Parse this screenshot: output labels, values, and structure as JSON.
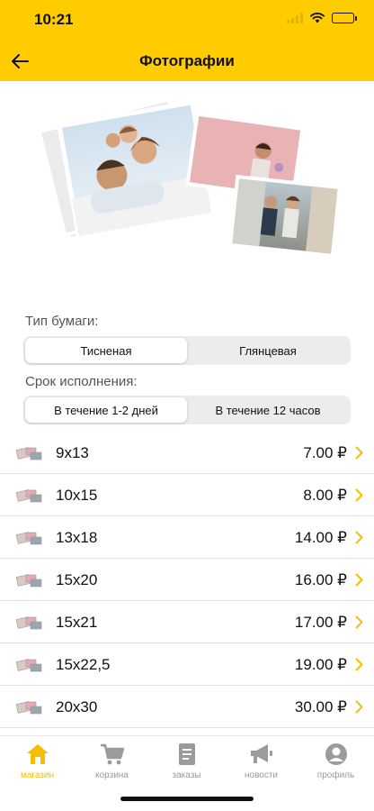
{
  "status_bar": {
    "time": "10:21"
  },
  "nav": {
    "title": "Фотографии",
    "back_icon": "arrow-left-icon"
  },
  "paper_type": {
    "label": "Тип бумаги:",
    "options": [
      "Тисненая",
      "Глянцевая"
    ],
    "selected": "Тисненая"
  },
  "deadline": {
    "label": "Срок исполнения:",
    "options": [
      "В течение 1-2 дней",
      "В течение 12 часов"
    ],
    "selected": "В течение 1-2 дней"
  },
  "sizes": [
    {
      "size": "9x13",
      "price": "7.00 ₽"
    },
    {
      "size": "10x15",
      "price": "8.00 ₽"
    },
    {
      "size": "13x18",
      "price": "14.00 ₽"
    },
    {
      "size": "15x20",
      "price": "16.00 ₽"
    },
    {
      "size": "15x21",
      "price": "17.00 ₽"
    },
    {
      "size": "15x22,5",
      "price": "19.00 ₽"
    },
    {
      "size": "20x30",
      "price": "30.00 ₽"
    }
  ],
  "tabbar": {
    "items": [
      {
        "label": "магазин",
        "icon": "home-icon",
        "active": true
      },
      {
        "label": "корзина",
        "icon": "cart-icon",
        "active": false
      },
      {
        "label": "заказы",
        "icon": "orders-icon",
        "active": false
      },
      {
        "label": "новости",
        "icon": "megaphone-icon",
        "active": false
      },
      {
        "label": "профиль",
        "icon": "profile-icon",
        "active": false
      }
    ]
  },
  "colors": {
    "brand": "#FFCC00",
    "accent": "#F5BE00",
    "chevron": "#F5BE00"
  }
}
